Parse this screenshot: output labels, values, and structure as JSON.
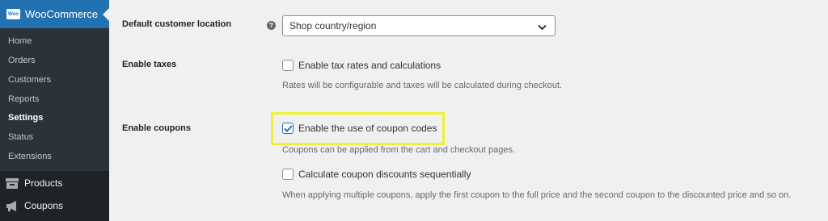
{
  "sidebar": {
    "brand": "WooCommerce",
    "brand_logo": "Woo",
    "submenu": [
      "Home",
      "Orders",
      "Customers",
      "Reports",
      "Settings",
      "Status",
      "Extensions"
    ],
    "current": "Settings",
    "menu": [
      {
        "label": "Products",
        "icon": "archive-box-icon"
      },
      {
        "label": "Coupons",
        "icon": "megaphone-icon"
      }
    ],
    "colors": {
      "bg": "#1d2327",
      "submenu_bg": "#2c3338",
      "accent": "#2271b1"
    }
  },
  "form": {
    "default_location": {
      "label": "Default customer location",
      "help_icon": "?",
      "selected": "Shop country/region"
    },
    "taxes": {
      "label": "Enable taxes",
      "checkbox_label": "Enable tax rates and calculations",
      "checked": false,
      "description": "Rates will be configurable and taxes will be calculated during checkout."
    },
    "coupons": {
      "label": "Enable coupons",
      "checkbox_label": "Enable the use of coupon codes",
      "checked": true,
      "description": "Coupons can be applied from the cart and checkout pages.",
      "sequential_label": "Calculate coupon discounts sequentially",
      "sequential_checked": false,
      "sequential_description": "When applying multiple coupons, apply the first coupon to the full price and the second coupon to the discounted price and so on."
    },
    "highlight_color": "#eef231"
  }
}
